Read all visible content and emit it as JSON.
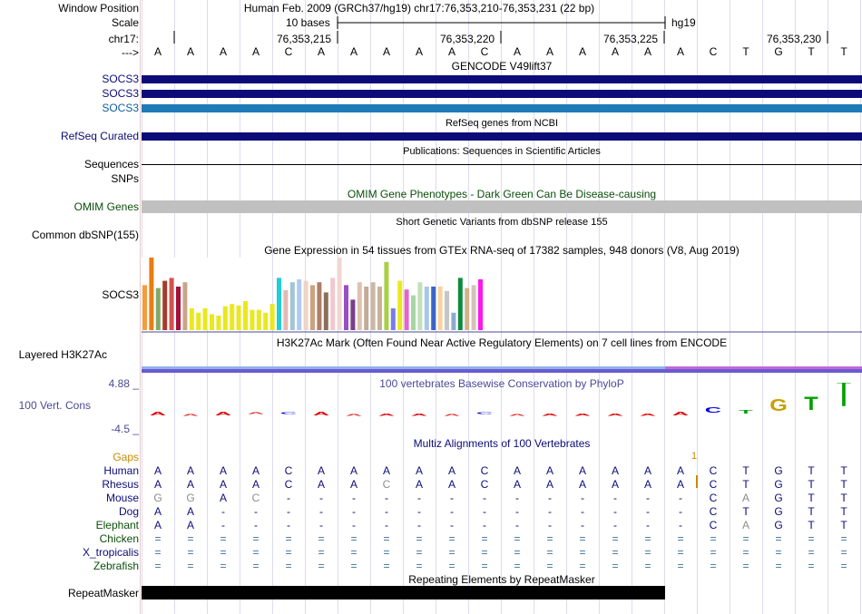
{
  "left_labels": {
    "window_position": "Window Position",
    "scale": "Scale",
    "chrom": "chr17:",
    "arrow": "--->",
    "socs3_1": "SOCS3",
    "socs3_2": "SOCS3",
    "socs3_3": "SOCS3",
    "refseq": "RefSeq Curated",
    "sequences": "Sequences",
    "snps": "SNPs",
    "omim": "OMIM Genes",
    "dbsnp": "Common dbSNP(155)",
    "gtex_gene": "SOCS3",
    "h3k27ac": "Layered H3K27Ac",
    "phylop_max": "4.88 _",
    "phylop_label": "100 Vert. Cons",
    "phylop_min": "-4.5 _",
    "gaps": "Gaps",
    "species": [
      "Human",
      "Rhesus",
      "Mouse",
      "Dog",
      "Elephant",
      "Chicken",
      "X_tropicalis",
      "Zebrafish"
    ],
    "repeatmasker": "RepeatMasker"
  },
  "header": {
    "assembly": "Human Feb. 2009 (GRCh37/hg19)   chr17:76,353,210-76,353,231 (22 bp)",
    "scale_text": "10 bases",
    "scale_db": "hg19",
    "coords": [
      "76,353,215",
      "76,353,220",
      "76,353,225",
      "76,353,230"
    ]
  },
  "sequence": [
    "A",
    "A",
    "A",
    "A",
    "C",
    "A",
    "A",
    "A",
    "A",
    "A",
    "C",
    "A",
    "A",
    "A",
    "A",
    "A",
    "A",
    "C",
    "T",
    "G",
    "T",
    "T"
  ],
  "track_titles": {
    "gencode": "GENCODE V49lift37",
    "refseq": "RefSeq genes from NCBI",
    "publications": "Publications: Sequences in Scientific Articles",
    "omim": "OMIM Gene Phenotypes - Dark Green Can Be Disease-causing",
    "snp": "Short Genetic Variants from dbSNP release 155",
    "gtex": "Gene Expression in 54 tissues from GTEx RNA-seq of 17382 samples, 948 donors (V8, Aug 2019)",
    "h3k27ac": "H3K27Ac Mark (Often Found Near Active Regulatory Elements) on 7 cell lines from ENCODE",
    "phylop": "100 vertebrates Basewise Conservation by PhyloP",
    "multiz": "Multiz Alignments of 100 Vertebrates",
    "repeat": "Repeating Elements by RepeatMasker"
  },
  "gaps_mark": "1",
  "alignment": {
    "Human": [
      "A",
      "A",
      "A",
      "A",
      "C",
      "A",
      "A",
      "A",
      "A",
      "A",
      "C",
      "A",
      "A",
      "A",
      "A",
      "A",
      "A",
      "C",
      "T",
      "G",
      "T",
      "T"
    ],
    "Rhesus": [
      "A",
      "A",
      "A",
      "A",
      "C",
      "A",
      "A",
      "C",
      "A",
      "A",
      "C",
      "A",
      "A",
      "A",
      "A",
      "A",
      "A",
      "C",
      "T",
      "G",
      "T",
      "T"
    ],
    "Mouse": [
      "G",
      "G",
      "A",
      "C",
      "-",
      "-",
      "-",
      "-",
      "-",
      "-",
      "-",
      "-",
      "-",
      "-",
      "-",
      "-",
      "-",
      "C",
      "A",
      "G",
      "T",
      "T"
    ],
    "Dog": [
      "A",
      "A",
      "-",
      "-",
      "-",
      "-",
      "-",
      "-",
      "-",
      "-",
      "-",
      "-",
      "-",
      "-",
      "-",
      "-",
      "-",
      "C",
      "T",
      "G",
      "T",
      "T"
    ],
    "Elephant": [
      "A",
      "A",
      "-",
      "-",
      "-",
      "-",
      "-",
      "-",
      "-",
      "-",
      "-",
      "-",
      "-",
      "-",
      "-",
      "-",
      "-",
      "C",
      "A",
      "G",
      "T",
      "T"
    ],
    "Chicken": [
      "=",
      "=",
      "=",
      "=",
      "=",
      "=",
      "=",
      "=",
      "=",
      "=",
      "=",
      "=",
      "=",
      "=",
      "=",
      "=",
      "=",
      "=",
      "=",
      "=",
      "=",
      "="
    ],
    "X_tropicalis": [
      "=",
      "=",
      "=",
      "=",
      "=",
      "=",
      "=",
      "=",
      "=",
      "=",
      "=",
      "=",
      "=",
      "=",
      "=",
      "=",
      "=",
      "=",
      "=",
      "=",
      "=",
      "="
    ],
    "Zebrafish": [
      "=",
      "=",
      "=",
      "=",
      "=",
      "=",
      "=",
      "=",
      "=",
      "=",
      "=",
      "=",
      "=",
      "=",
      "=",
      "=",
      "=",
      "=",
      "=",
      "=",
      "=",
      "="
    ]
  },
  "gtex_values": [
    {
      "v": 0.62,
      "c": "#f59b3c"
    },
    {
      "v": 1.0,
      "c": "#e87d10"
    },
    {
      "v": 0.58,
      "c": "#84a86a"
    },
    {
      "v": 0.68,
      "c": "#a33d2b"
    },
    {
      "v": 0.72,
      "c": "#d5524d"
    },
    {
      "v": 0.6,
      "c": "#a3113c"
    },
    {
      "v": 0.66,
      "c": "#c6a68b"
    },
    {
      "v": 0.3,
      "c": "#eae81e"
    },
    {
      "v": 0.24,
      "c": "#eae81e"
    },
    {
      "v": 0.3,
      "c": "#eae81e"
    },
    {
      "v": 0.22,
      "c": "#eae81e"
    },
    {
      "v": 0.2,
      "c": "#eae81e"
    },
    {
      "v": 0.33,
      "c": "#eae81e"
    },
    {
      "v": 0.36,
      "c": "#eae81e"
    },
    {
      "v": 0.34,
      "c": "#eae81e"
    },
    {
      "v": 0.4,
      "c": "#eae81e"
    },
    {
      "v": 0.28,
      "c": "#eae81e"
    },
    {
      "v": 0.28,
      "c": "#eae81e"
    },
    {
      "v": 0.24,
      "c": "#eae81e"
    },
    {
      "v": 0.36,
      "c": "#eae81e"
    },
    {
      "v": 0.72,
      "c": "#1ecfd8"
    },
    {
      "v": 0.55,
      "c": "#e3b9b3"
    },
    {
      "v": 0.66,
      "c": "#9ec6d5"
    },
    {
      "v": 0.7,
      "c": "#b0caf0"
    },
    {
      "v": 0.68,
      "c": "#eed4c8"
    },
    {
      "v": 0.62,
      "c": "#cda27f"
    },
    {
      "v": 0.66,
      "c": "#ad7e6a"
    },
    {
      "v": 0.52,
      "c": "#8a7058"
    },
    {
      "v": 0.72,
      "c": "#f2c8d0"
    },
    {
      "v": 1.0,
      "c": "#efd7d2"
    },
    {
      "v": 0.62,
      "c": "#9a4ec4"
    },
    {
      "v": 0.42,
      "c": "#7a3d8c"
    },
    {
      "v": 0.66,
      "c": "#dcc2b0"
    },
    {
      "v": 0.6,
      "c": "#c3ab95"
    },
    {
      "v": 0.66,
      "c": "#cbb8a2"
    },
    {
      "v": 0.6,
      "c": "#c8b29a"
    },
    {
      "v": 0.94,
      "c": "#a8d045"
    },
    {
      "v": 0.3,
      "c": "#7c7ce8"
    },
    {
      "v": 0.68,
      "c": "#e9e91b"
    },
    {
      "v": 0.56,
      "c": "#e266c8"
    },
    {
      "v": 0.48,
      "c": "#a9d4a6"
    },
    {
      "v": 0.66,
      "c": "#c1e0b8"
    },
    {
      "v": 0.6,
      "c": "#a7c6ea"
    },
    {
      "v": 0.6,
      "c": "#3c64c8"
    },
    {
      "v": 0.6,
      "c": "#f9d1a1"
    },
    {
      "v": 0.54,
      "c": "#c6c6c6"
    },
    {
      "v": 0.24,
      "c": "#8eaad0"
    },
    {
      "v": 0.72,
      "c": "#0f8a3e"
    },
    {
      "v": 0.58,
      "c": "#d1b28d"
    },
    {
      "v": 0.62,
      "c": "#d4c2b8"
    },
    {
      "v": 0.7,
      "c": "#ff17f0"
    }
  ],
  "phylop_values": [
    -0.3,
    -0.1,
    -0.3,
    0.0,
    0.0,
    -0.3,
    -0.1,
    -0.2,
    -0.2,
    -0.1,
    0.0,
    -0.1,
    -0.2,
    -0.2,
    -0.2,
    -0.2,
    -0.3,
    0.5,
    0.3,
    1.1,
    1.3,
    2.6
  ],
  "colors": {
    "gencode": "#0c0c78",
    "gencode_light": "#1f7ab8",
    "omim": "#c0c0c0",
    "repeat": "#000000",
    "h3k27ac_a": "#9b7ee0",
    "h3k27ac_b": "#7090e0",
    "h3k27ac_c": "#3a1a6e"
  }
}
